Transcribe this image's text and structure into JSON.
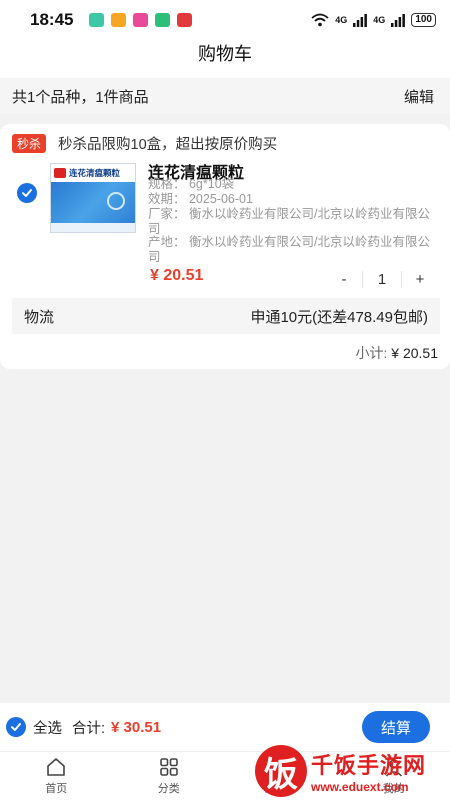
{
  "status_bar": {
    "time": "18:45",
    "battery": "100",
    "signal": "4G",
    "notif_colors": [
      "#3cc8a6",
      "#f5a623",
      "#e94b9a",
      "#2bbf7a",
      "#e23a3a"
    ]
  },
  "nav": {
    "title": "购物车"
  },
  "summary": {
    "text": "共1个品种，1件商品",
    "edit_label": "编辑"
  },
  "cart": {
    "promo_badge": "秒杀",
    "promo_text": "秒杀品限购10盒，超出按原价购买",
    "item": {
      "name": "连花清瘟颗粒",
      "image_label": "连花清瘟颗粒",
      "spec": "规格：  6g*10袋",
      "expiry": "效期：  2025-06-01",
      "manufacturer": "厂家：  衡水以岭药业有限公司/北京以岭药业有限公司",
      "origin": "产地：  衡水以岭药业有限公司/北京以岭药业有限公司",
      "price": "¥ 20.51",
      "quantity": "1",
      "minus": "-",
      "plus": "+",
      "checked": true
    },
    "logistics_label": "物流",
    "logistics_value": "申通10元(还差478.49包邮)",
    "subtotal_label": "小计: ",
    "subtotal_amount": "¥ 20.51"
  },
  "checkout": {
    "select_all": "全选",
    "total_label": "合计:",
    "total_amount": "¥ 30.51",
    "pay_label": "结算"
  },
  "tabs": [
    {
      "label": "首页",
      "icon": "home-icon"
    },
    {
      "label": "分类",
      "icon": "grid-icon"
    },
    {
      "label": "购物车",
      "icon": "cart-icon"
    },
    {
      "label": "我的",
      "icon": "user-icon"
    }
  ],
  "watermark": {
    "logo_char": "饭",
    "text": "千饭手游网",
    "url": "www.eduext.com"
  },
  "colors": {
    "accent": "#1b6fe0",
    "price": "#e8402a",
    "badge": "#e8402a"
  }
}
